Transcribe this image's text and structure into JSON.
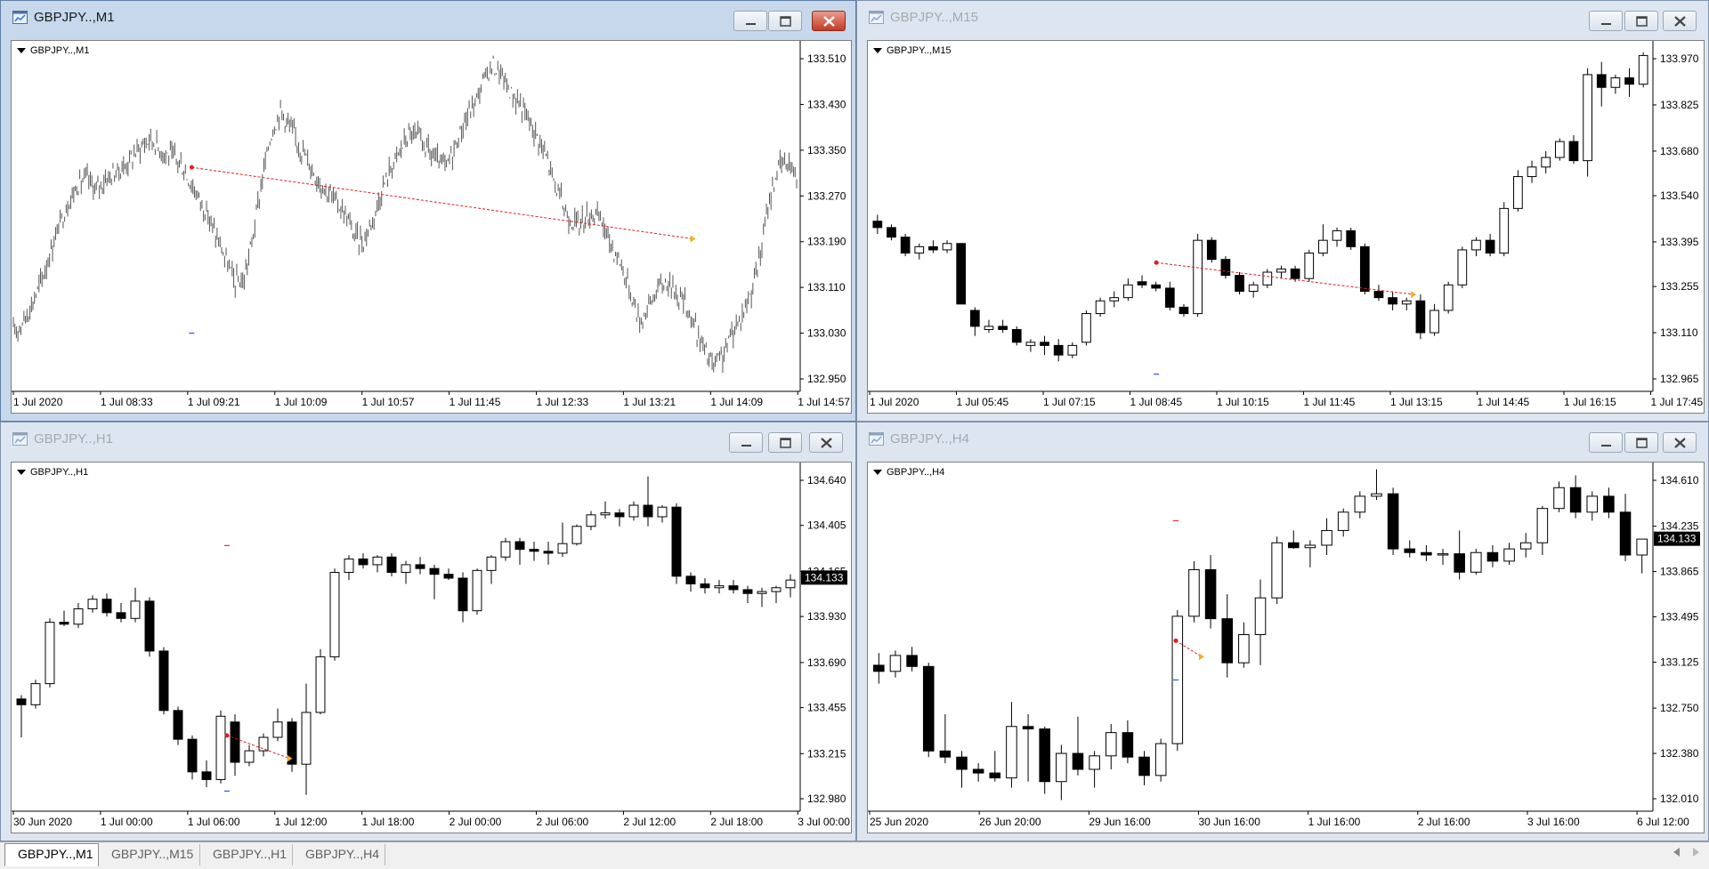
{
  "windows": [
    {
      "title": "GBPJPY..,M1",
      "label": "GBPJPY..,M1",
      "active": true,
      "style": "bars",
      "price_labels": [
        "133.510",
        "133.430",
        "133.350",
        "133.270",
        "133.190",
        "133.110",
        "133.030",
        "132.950"
      ],
      "time_labels": [
        "1 Jul 2020",
        "1 Jul 08:33",
        "1 Jul 09:21",
        "1 Jul 10:09",
        "1 Jul 10:57",
        "1 Jul 11:45",
        "1 Jul 12:33",
        "1 Jul 13:21",
        "1 Jul 14:09",
        "1 Jul 14:57"
      ],
      "prices": [
        133.03,
        133.05,
        133.08,
        133.12,
        133.17,
        133.22,
        133.26,
        133.29,
        133.3,
        133.28,
        133.3,
        133.31,
        133.32,
        133.34,
        133.36,
        133.37,
        133.35,
        133.34,
        133.33,
        133.3,
        133.27,
        133.24,
        133.2,
        133.16,
        133.12,
        133.12,
        133.2,
        133.3,
        133.38,
        133.42,
        133.39,
        133.36,
        133.33,
        133.3,
        133.28,
        133.26,
        133.24,
        133.2,
        133.19,
        133.23,
        133.28,
        133.32,
        133.35,
        133.38,
        133.37,
        133.35,
        133.33,
        133.32,
        133.36,
        133.4,
        133.43,
        133.47,
        133.5,
        133.48,
        133.45,
        133.43,
        133.4,
        133.37,
        133.33,
        133.28,
        133.24,
        133.22,
        133.23,
        133.24,
        133.22,
        133.18,
        133.15,
        133.1,
        133.05,
        133.08,
        133.11,
        133.12,
        133.1,
        133.08,
        133.04,
        133.0,
        132.97,
        132.99,
        133.03,
        133.06,
        133.1,
        133.16,
        133.26,
        133.32,
        133.33,
        133.31
      ],
      "marker_start": 0.23,
      "marker_end": 0.87,
      "line_from": 133.32,
      "line_to": 133.195,
      "dash": 133.03,
      "dash_pos": 0.23,
      "dash_color": "#3050ff"
    },
    {
      "title": "GBPJPY..,M15",
      "label": "GBPJPY..,M15",
      "active": false,
      "style": "candles",
      "price_labels": [
        "133.970",
        "133.825",
        "133.680",
        "133.540",
        "133.395",
        "133.255",
        "133.110",
        "132.965"
      ],
      "time_labels": [
        "1 Jul 2020",
        "1 Jul 05:45",
        "1 Jul 07:15",
        "1 Jul 08:45",
        "1 Jul 10:15",
        "1 Jul 11:45",
        "1 Jul 13:15",
        "1 Jul 14:45",
        "1 Jul 16:15",
        "1 Jul 17:45"
      ],
      "ohlc": [
        [
          133.46,
          133.48,
          133.42,
          133.44
        ],
        [
          133.44,
          133.45,
          133.4,
          133.41
        ],
        [
          133.41,
          133.42,
          133.35,
          133.36
        ],
        [
          133.36,
          133.39,
          133.34,
          133.38
        ],
        [
          133.38,
          133.4,
          133.36,
          133.37
        ],
        [
          133.37,
          133.4,
          133.36,
          133.39
        ],
        [
          133.39,
          133.39,
          133.2,
          133.2
        ],
        [
          133.18,
          133.19,
          133.1,
          133.13
        ],
        [
          133.12,
          133.15,
          133.11,
          133.13
        ],
        [
          133.13,
          133.15,
          133.11,
          133.12
        ],
        [
          133.12,
          133.13,
          133.07,
          133.08
        ],
        [
          133.07,
          133.09,
          133.05,
          133.08
        ],
        [
          133.08,
          133.1,
          133.04,
          133.07
        ],
        [
          133.07,
          133.09,
          133.02,
          133.04
        ],
        [
          133.04,
          133.08,
          133.03,
          133.07
        ],
        [
          133.08,
          133.18,
          133.07,
          133.17
        ],
        [
          133.17,
          133.22,
          133.16,
          133.21
        ],
        [
          133.21,
          133.24,
          133.19,
          133.22
        ],
        [
          133.22,
          133.28,
          133.21,
          133.26
        ],
        [
          133.27,
          133.29,
          133.25,
          133.26
        ],
        [
          133.26,
          133.27,
          133.24,
          133.25
        ],
        [
          133.25,
          133.27,
          133.18,
          133.19
        ],
        [
          133.19,
          133.2,
          133.16,
          133.17
        ],
        [
          133.17,
          133.42,
          133.16,
          133.4
        ],
        [
          133.4,
          133.41,
          133.33,
          133.34
        ],
        [
          133.34,
          133.35,
          133.28,
          133.29
        ],
        [
          133.29,
          133.3,
          133.23,
          133.24
        ],
        [
          133.24,
          133.27,
          133.22,
          133.26
        ],
        [
          133.26,
          133.31,
          133.25,
          133.3
        ],
        [
          133.3,
          133.32,
          133.28,
          133.31
        ],
        [
          133.31,
          133.32,
          133.27,
          133.28
        ],
        [
          133.28,
          133.37,
          133.27,
          133.36
        ],
        [
          133.36,
          133.45,
          133.35,
          133.4
        ],
        [
          133.4,
          133.44,
          133.38,
          133.43
        ],
        [
          133.43,
          133.44,
          133.37,
          133.38
        ],
        [
          133.38,
          133.39,
          133.23,
          133.24
        ],
        [
          133.24,
          133.26,
          133.21,
          133.22
        ],
        [
          133.22,
          133.24,
          133.18,
          133.2
        ],
        [
          133.2,
          133.22,
          133.18,
          133.21
        ],
        [
          133.21,
          133.23,
          133.09,
          133.11
        ],
        [
          133.11,
          133.2,
          133.1,
          133.18
        ],
        [
          133.18,
          133.27,
          133.17,
          133.26
        ],
        [
          133.26,
          133.38,
          133.25,
          133.37
        ],
        [
          133.37,
          133.41,
          133.35,
          133.4
        ],
        [
          133.4,
          133.42,
          133.35,
          133.36
        ],
        [
          133.36,
          133.52,
          133.35,
          133.5
        ],
        [
          133.5,
          133.62,
          133.49,
          133.6
        ],
        [
          133.6,
          133.65,
          133.58,
          133.63
        ],
        [
          133.63,
          133.68,
          133.61,
          133.66
        ],
        [
          133.66,
          133.72,
          133.65,
          133.71
        ],
        [
          133.71,
          133.73,
          133.64,
          133.65
        ],
        [
          133.65,
          133.94,
          133.6,
          133.92
        ],
        [
          133.92,
          133.96,
          133.82,
          133.88
        ],
        [
          133.88,
          133.92,
          133.86,
          133.91
        ],
        [
          133.91,
          133.94,
          133.85,
          133.89
        ],
        [
          133.89,
          133.99,
          133.88,
          133.98
        ]
      ],
      "marker_start": 0.37,
      "marker_end": 0.7,
      "line_from": 133.33,
      "line_to": 133.23,
      "dash": 132.98,
      "dash_pos": 0.37,
      "dash_color": "#3050ff"
    },
    {
      "title": "GBPJPY..,H1",
      "label": "GBPJPY..,H1",
      "active": false,
      "style": "candles",
      "price_labels": [
        "134.640",
        "134.405",
        "134.165",
        "133.930",
        "133.690",
        "133.455",
        "133.215",
        "132.980"
      ],
      "time_labels": [
        "30 Jun 2020",
        "1 Jul 00:00",
        "1 Jul 06:00",
        "1 Jul 12:00",
        "1 Jul 18:00",
        "2 Jul 00:00",
        "2 Jul 06:00",
        "2 Jul 12:00",
        "2 Jul 18:00",
        "3 Jul 00:00"
      ],
      "current_price": "134.133",
      "ohlc": [
        [
          133.5,
          133.52,
          133.3,
          133.47
        ],
        [
          133.47,
          133.6,
          133.45,
          133.58
        ],
        [
          133.58,
          133.92,
          133.56,
          133.9
        ],
        [
          133.9,
          133.96,
          133.88,
          133.89
        ],
        [
          133.89,
          134.0,
          133.87,
          133.97
        ],
        [
          133.97,
          134.04,
          133.95,
          134.02
        ],
        [
          134.02,
          134.05,
          133.93,
          133.95
        ],
        [
          133.95,
          134.0,
          133.9,
          133.92
        ],
        [
          133.92,
          134.08,
          133.9,
          134.01
        ],
        [
          134.01,
          134.03,
          133.72,
          133.75
        ],
        [
          133.75,
          133.77,
          133.42,
          133.44
        ],
        [
          133.44,
          133.46,
          133.26,
          133.29
        ],
        [
          133.29,
          133.31,
          133.08,
          133.12
        ],
        [
          133.12,
          133.18,
          133.04,
          133.08
        ],
        [
          133.08,
          133.44,
          133.06,
          133.41
        ],
        [
          133.38,
          133.42,
          133.1,
          133.17
        ],
        [
          133.17,
          133.26,
          133.15,
          133.23
        ],
        [
          133.23,
          133.32,
          133.2,
          133.3
        ],
        [
          133.3,
          133.45,
          133.28,
          133.38
        ],
        [
          133.38,
          133.4,
          133.12,
          133.16
        ],
        [
          133.16,
          133.58,
          133.0,
          133.43
        ],
        [
          133.43,
          133.76,
          133.42,
          133.72
        ],
        [
          133.72,
          134.18,
          133.7,
          134.16
        ],
        [
          134.16,
          134.25,
          134.12,
          134.23
        ],
        [
          134.23,
          134.26,
          134.18,
          134.2
        ],
        [
          134.2,
          134.25,
          134.16,
          134.24
        ],
        [
          134.24,
          134.26,
          134.14,
          134.16
        ],
        [
          134.16,
          134.22,
          134.1,
          134.2
        ],
        [
          134.2,
          134.24,
          134.15,
          134.18
        ],
        [
          134.18,
          134.2,
          134.02,
          134.15
        ],
        [
          134.15,
          134.18,
          134.12,
          134.13
        ],
        [
          134.13,
          134.16,
          133.9,
          133.96
        ],
        [
          133.96,
          134.18,
          133.94,
          134.17
        ],
        [
          134.17,
          134.25,
          134.1,
          134.24
        ],
        [
          134.24,
          134.34,
          134.22,
          134.32
        ],
        [
          134.32,
          134.34,
          134.2,
          134.28
        ],
        [
          134.28,
          134.32,
          134.22,
          134.27
        ],
        [
          134.27,
          134.32,
          134.2,
          134.26
        ],
        [
          134.26,
          134.42,
          134.24,
          134.31
        ],
        [
          134.31,
          134.41,
          134.3,
          134.4
        ],
        [
          134.4,
          134.48,
          134.38,
          134.46
        ],
        [
          134.46,
          134.53,
          134.44,
          134.47
        ],
        [
          134.47,
          134.49,
          134.4,
          134.45
        ],
        [
          134.45,
          134.53,
          134.43,
          134.51
        ],
        [
          134.51,
          134.66,
          134.4,
          134.45
        ],
        [
          134.45,
          134.51,
          134.42,
          134.5
        ],
        [
          134.5,
          134.52,
          134.1,
          134.14
        ],
        [
          134.14,
          134.16,
          134.06,
          134.1
        ],
        [
          134.1,
          134.13,
          134.05,
          134.08
        ],
        [
          134.08,
          134.12,
          134.05,
          134.09
        ],
        [
          134.09,
          134.12,
          134.05,
          134.07
        ],
        [
          134.07,
          134.09,
          134.0,
          134.05
        ],
        [
          134.05,
          134.08,
          133.98,
          134.06
        ],
        [
          134.06,
          134.09,
          134.0,
          134.08
        ],
        [
          134.08,
          134.15,
          134.03,
          134.12
        ]
      ],
      "marker_start": 0.275,
      "marker_end": 0.355,
      "line_from": 133.31,
      "line_to": 133.19,
      "dash": 133.02,
      "dash_pos": 0.275,
      "dash_color": "#3050ff",
      "dash2": 134.3,
      "dash2_pos": 0.275,
      "dash2_color": "#e03030"
    },
    {
      "title": "GBPJPY..,H4",
      "label": "GBPJPY..,H4",
      "active": false,
      "style": "candles",
      "price_labels": [
        "134.610",
        "134.235",
        "133.865",
        "133.495",
        "133.125",
        "132.750",
        "132.380",
        "132.010"
      ],
      "time_labels": [
        "25 Jun 2020",
        "26 Jun 20:00",
        "29 Jun 16:00",
        "30 Jun 16:00",
        "1 Jul 16:00",
        "2 Jul 16:00",
        "3 Jul 16:00",
        "6 Jul 12:00"
      ],
      "current_price": "134.133",
      "ohlc": [
        [
          133.1,
          133.2,
          132.95,
          133.05
        ],
        [
          133.05,
          133.22,
          133.0,
          133.18
        ],
        [
          133.18,
          133.25,
          133.05,
          133.09
        ],
        [
          133.09,
          133.12,
          132.35,
          132.4
        ],
        [
          132.4,
          132.7,
          132.3,
          132.35
        ],
        [
          132.35,
          132.4,
          132.1,
          132.25
        ],
        [
          132.25,
          132.3,
          132.15,
          132.22
        ],
        [
          132.22,
          132.4,
          132.15,
          132.18
        ],
        [
          132.18,
          132.8,
          132.1,
          132.6
        ],
        [
          132.6,
          132.7,
          132.15,
          132.58
        ],
        [
          132.58,
          132.6,
          132.05,
          132.15
        ],
        [
          132.15,
          132.45,
          132.0,
          132.38
        ],
        [
          132.38,
          132.68,
          132.2,
          132.25
        ],
        [
          132.25,
          132.4,
          132.1,
          132.36
        ],
        [
          132.36,
          132.62,
          132.25,
          132.55
        ],
        [
          132.55,
          132.65,
          132.3,
          132.35
        ],
        [
          132.35,
          132.4,
          132.12,
          132.2
        ],
        [
          132.2,
          132.5,
          132.15,
          132.46
        ],
        [
          132.46,
          133.55,
          132.4,
          133.5
        ],
        [
          133.5,
          133.95,
          133.45,
          133.88
        ],
        [
          133.88,
          134.0,
          133.4,
          133.48
        ],
        [
          133.48,
          133.68,
          133.0,
          133.12
        ],
        [
          133.12,
          133.45,
          133.08,
          133.35
        ],
        [
          133.35,
          133.8,
          133.1,
          133.65
        ],
        [
          133.65,
          134.15,
          133.6,
          134.1
        ],
        [
          134.1,
          134.2,
          134.05,
          134.06
        ],
        [
          134.06,
          134.12,
          133.9,
          134.08
        ],
        [
          134.08,
          134.3,
          134.0,
          134.2
        ],
        [
          134.2,
          134.38,
          134.15,
          134.35
        ],
        [
          134.35,
          134.52,
          134.3,
          134.48
        ],
        [
          134.48,
          134.7,
          134.45,
          134.5
        ],
        [
          134.5,
          134.55,
          134.0,
          134.05
        ],
        [
          134.05,
          134.12,
          133.98,
          134.02
        ],
        [
          134.02,
          134.08,
          133.95,
          134.0
        ],
        [
          134.0,
          134.05,
          133.92,
          134.01
        ],
        [
          134.01,
          134.2,
          133.8,
          133.86
        ],
        [
          133.86,
          134.05,
          133.84,
          134.02
        ],
        [
          134.02,
          134.08,
          133.9,
          133.95
        ],
        [
          133.95,
          134.1,
          133.92,
          134.05
        ],
        [
          134.05,
          134.18,
          133.98,
          134.1
        ],
        [
          134.1,
          134.4,
          134.0,
          134.38
        ],
        [
          134.38,
          134.6,
          134.35,
          134.55
        ],
        [
          134.55,
          134.65,
          134.3,
          134.35
        ],
        [
          134.35,
          134.52,
          134.28,
          134.48
        ],
        [
          134.48,
          134.55,
          134.3,
          134.35
        ],
        [
          134.35,
          134.5,
          133.95,
          134.0
        ],
        [
          134.0,
          134.05,
          133.85,
          134.13
        ]
      ],
      "marker_start": 0.395,
      "marker_end": 0.428,
      "line_from": 133.3,
      "line_to": 133.17,
      "dash": 132.98,
      "dash_pos": 0.395,
      "dash_color": "#3050ff",
      "dash2": 134.28,
      "dash2_pos": 0.395,
      "dash2_color": "#e03030"
    }
  ],
  "tabs": [
    {
      "label": "GBPJPY..,M1",
      "active": true
    },
    {
      "label": "GBPJPY..,M15",
      "active": false
    },
    {
      "label": "GBPJPY..,H1",
      "active": false
    },
    {
      "label": "GBPJPY..,H4",
      "active": false
    }
  ],
  "icons": {
    "window": "chart-window-icon",
    "minimize": "minimize-icon",
    "maximize": "maximize-icon",
    "close": "close-icon",
    "dropdown": "dropdown-triangle-icon"
  },
  "colors": {
    "bull": "#ffffff",
    "bear": "#000000",
    "trend_line": "#e02020",
    "current_price_bg": "#000000",
    "current_price_text": "#ffffff",
    "bar_line": "#555555"
  }
}
